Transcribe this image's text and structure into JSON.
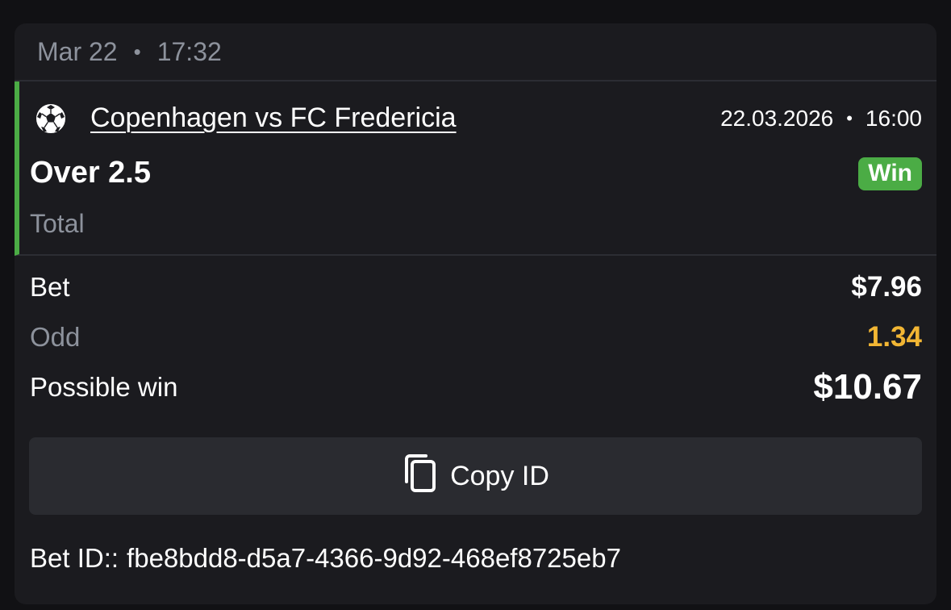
{
  "header": {
    "date": "Mar 22",
    "separator": "•",
    "time": "17:32"
  },
  "event": {
    "sport_icon": "soccer-ball-icon",
    "match": "Copenhagen vs FC Fredericia",
    "date": "22.03.2026",
    "separator": "•",
    "time": "16:00",
    "selection": "Over 2.5",
    "result": "Win",
    "market": "Total",
    "accent_color": "#4bac45"
  },
  "summary": {
    "bet_label": "Bet",
    "bet_value": "$7.96",
    "odd_label": "Odd",
    "odd_value": "1.34",
    "possible_win_label": "Possible win",
    "possible_win_value": "$10.67",
    "odd_color": "#f2b634"
  },
  "actions": {
    "copy_icon": "copy-icon",
    "copy_label": "Copy ID"
  },
  "footer": {
    "bet_id_label": "Bet ID::",
    "bet_id_value": "fbe8bdd8-d5a7-4366-9d92-468ef8725eb7"
  }
}
